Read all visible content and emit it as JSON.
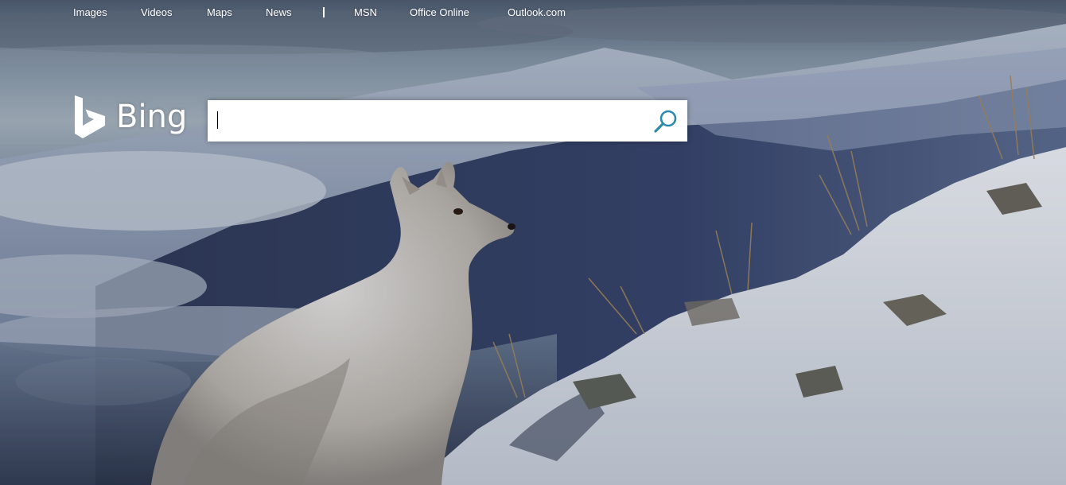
{
  "nav": {
    "items": [
      "Images",
      "Videos",
      "Maps",
      "News",
      "MSN",
      "Office Online",
      "Outlook.com"
    ]
  },
  "logo": {
    "text": "Bing",
    "icon": "bing-b-icon"
  },
  "search": {
    "value": "",
    "placeholder": "",
    "icon": "search-icon"
  },
  "colors": {
    "nav_text": "#ffffff",
    "search_icon": "#2b8bad",
    "sky": "#7d93a6",
    "mountain": "#33405f",
    "snow": "#e8ecf2"
  }
}
